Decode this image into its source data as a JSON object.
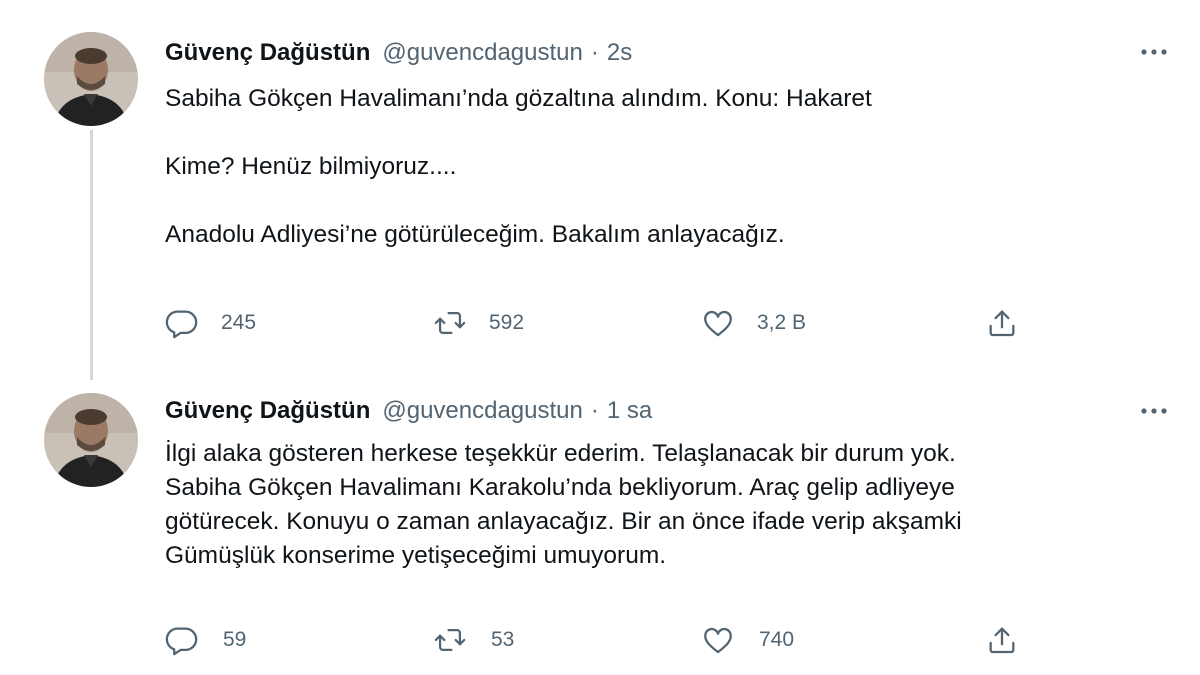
{
  "tweets": [
    {
      "author_name": "Güvenç Dağüstün",
      "author_handle": "@guvencdagustun",
      "separator": "·",
      "time": "2s",
      "paragraphs": [
        "Sabiha Gökçen Havalimanı’nda gözaltına alındım. Konu: Hakaret",
        "Kime? Henüz bilmiyoruz....",
        "Anadolu Adliyesi’ne götürüleceğim. Bakalım anlayacağız."
      ],
      "replies": "245",
      "retweets": "592",
      "likes": "3,2 B"
    },
    {
      "author_name": "Güvenç Dağüstün",
      "author_handle": "@guvencdagustun",
      "separator": "·",
      "time": "1 sa",
      "lines": [
        "İlgi alaka gösteren herkese teşekkür ederim. Telaşlanacak bir durum yok.",
        "Sabiha Gökçen Havalimanı Karakolu’nda bekliyorum. Araç gelip adliyeye",
        "götürecek. Konuyu o zaman anlayacağız. Bir an önce ifade verip akşamki",
        "Gümüşlük konserime yetişeceğimi umuyorum."
      ],
      "replies": "59",
      "retweets": "53",
      "likes": "740"
    }
  ],
  "icons": {
    "reply": "reply-icon",
    "retweet": "retweet-icon",
    "like": "heart-icon",
    "share": "share-icon",
    "more": "more-icon"
  },
  "colors": {
    "text": "#0f1419",
    "secondary": "#536471",
    "thread_line": "#cfd9de"
  }
}
